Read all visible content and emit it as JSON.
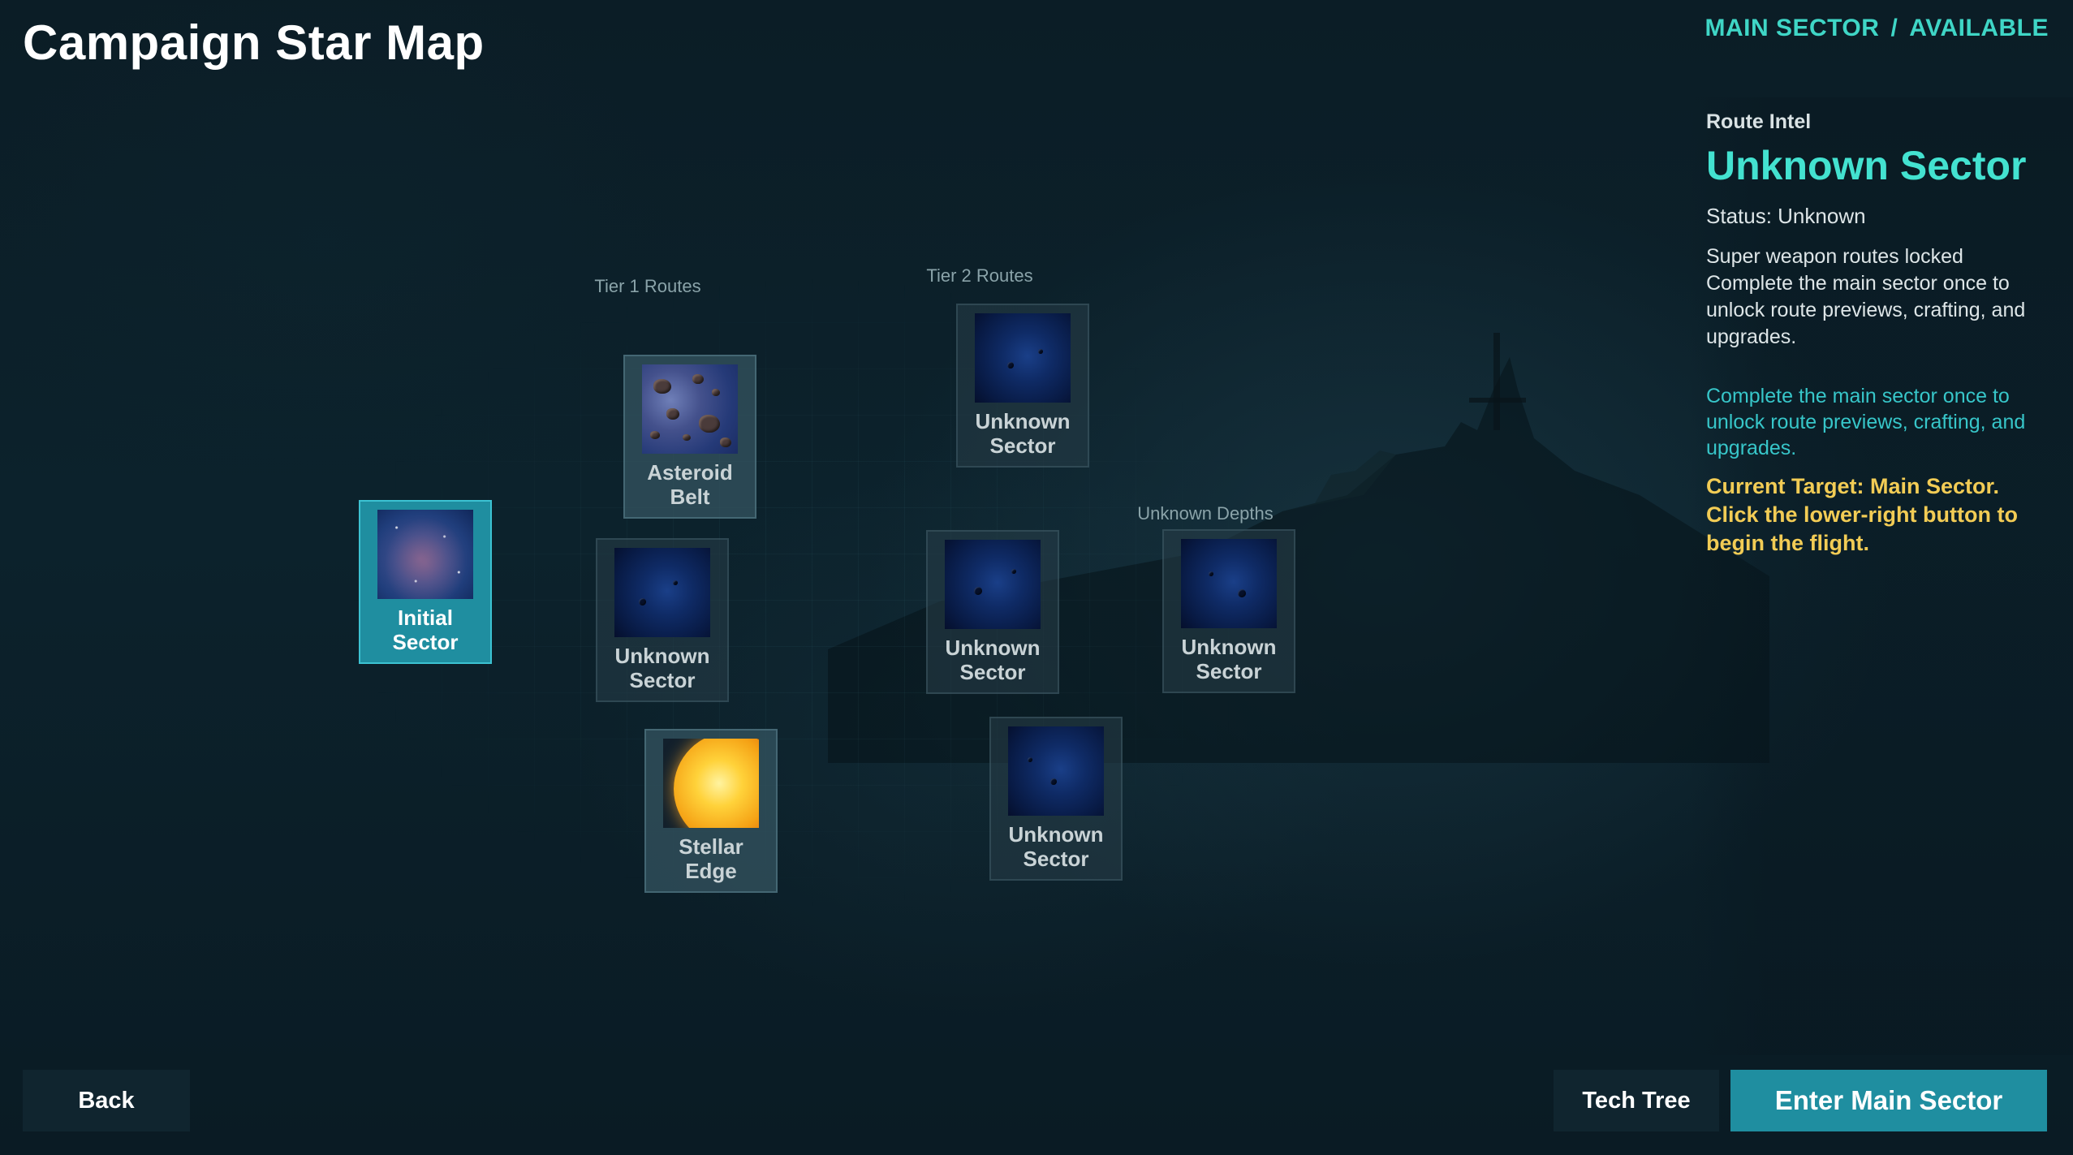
{
  "header": {
    "title": "Campaign Star Map",
    "breadcrumb": [
      "MAIN SECTOR",
      "AVAILABLE"
    ],
    "breadcrumb_separator": "/"
  },
  "map": {
    "tier_labels": {
      "tier1": "Tier 1 Routes",
      "tier2": "Tier 2 Routes",
      "unknown_depths": "Unknown Depths"
    },
    "nodes": {
      "initial": {
        "label": "Initial Sector",
        "selected": true
      },
      "asteroid": {
        "label": "Asteroid Belt"
      },
      "tier1_unknown": {
        "label": "Unknown Sector"
      },
      "stellar": {
        "label": "Stellar Edge"
      },
      "tier2_top": {
        "label": "Unknown Sector"
      },
      "tier2_mid": {
        "label": "Unknown Sector"
      },
      "tier2_bottom": {
        "label": "Unknown Sector"
      },
      "depths": {
        "label": "Unknown Sector"
      }
    }
  },
  "intel": {
    "header": "Route Intel",
    "title": "Unknown Sector",
    "status": "Status: Unknown",
    "lock_line": "Super weapon routes locked",
    "lock_detail": "Complete the main sector once to unlock route previews, crafting, and upgrades.",
    "hint": "Complete the main sector once to unlock route previews, crafting, and upgrades.",
    "target": "Current Target: Main Sector. Click the lower-right button to begin the flight."
  },
  "buttons": {
    "back": "Back",
    "tech_tree": "Tech Tree",
    "enter": "Enter Main Sector"
  },
  "colors": {
    "accent": "#43e2d0",
    "selected_node": "#1f8ea0",
    "target_text": "#f2cc55",
    "hint_text": "#37c6c9",
    "background": "#0a1b24"
  },
  "icons": {
    "initial": "nebula-icon",
    "asteroid": "asteroid-field-icon",
    "stellar": "sun-icon",
    "unknown": "unknown-space-icon"
  }
}
